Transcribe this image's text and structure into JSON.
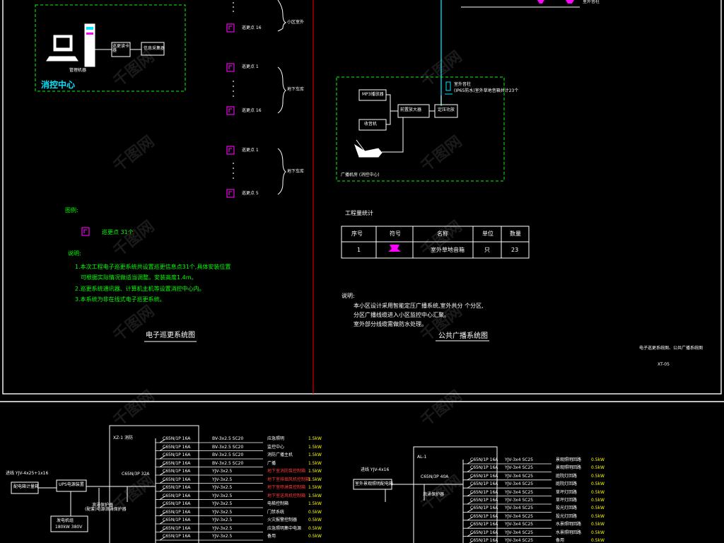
{
  "patrol": {
    "control_center_title": "消控中心",
    "computer_label": "管理机器",
    "box_interface": "巡更读卡器",
    "box_transmit": "信息采集器",
    "pt_top_upper": "巡更点 16",
    "pt_1a": "巡更点 1",
    "pt_16a": "巡更点 16",
    "pt_1b": "巡更点 1",
    "pt_5": "巡更点 5",
    "group_1": "小区室外",
    "group_2": "地下车库",
    "group_3": "地下车库",
    "legend_title": "图例:",
    "legend_item": "巡更点 31个",
    "notes_title": "说明:",
    "note_1": "1.本次工程电子巡更系统共设置巡更信息点31个,具体安装位置",
    "note_1b": "可根据实际情况做适当调整。安装高度1.4m。",
    "note_2": "2.巡更系统通讯器、计算机主机等设置消控中心内。",
    "note_3": "3.本系统为非在线式电子巡更系统。",
    "title": "电子巡更系统图"
  },
  "broadcast": {
    "box_mp3": "MP3播放器",
    "box_tuner": "收音机",
    "box_matrix": "前置放大器",
    "box_amp": "定压功放",
    "speaker_note_1": "室外音柱",
    "speaker_note_2": "(IP65防水)室外草地音箱共计23个",
    "room_label": "广播机房 (消控中心)",
    "top_note": "室外音柱",
    "qty_title": "工程量统计",
    "table_headers": [
      "序号",
      "符号",
      "名称",
      "单位",
      "数量"
    ],
    "table_rows": [
      {
        "no": "1",
        "name": "室外草地音箱",
        "unit": "只",
        "qty": "23"
      }
    ],
    "notes_title": "说明:",
    "note_1": "本小区设计采用智能定压广播系统,室外共分 个分区,",
    "note_2": "分区广播线缆进入小区监控中心汇聚。",
    "note_3": "室外部分线缆需做防水处理。",
    "title": "公共广播系统图",
    "frame_caption": "电子巡更系统图、公共广播系统图",
    "frame_code": "XT-05"
  },
  "panel_left": {
    "incoming_label": "进线 YJV-4x25+1x16",
    "meter_box": "配电箱计量箱",
    "main_switch_box": "UPS电源装置",
    "breaker_label": "C65N/3P 32A",
    "spd_label": "浪涌保护器",
    "spd_sub": "(配套)电源浪涌保护器",
    "gen_box_1": "发电机组",
    "gen_box_2": "180kW 380V",
    "cabinet_header": "XZ-1 消防",
    "circuits": [
      {
        "brk": "C65N/1P 16A",
        "cable": "BV-3x2.5 SC20",
        "name": "应急照明",
        "load": "1.5kW",
        "red": false
      },
      {
        "brk": "C65N/1P 16A",
        "cable": "BV-3x2.5 SC20",
        "name": "监控中心",
        "load": "1.5kW",
        "red": false
      },
      {
        "brk": "C65N/1P 16A",
        "cable": "BV-3x2.5 SC20",
        "name": "消防广播主机",
        "load": "1.5kW",
        "red": false
      },
      {
        "brk": "C65N/1P 16A",
        "cable": "BV-3x2.5 SC20",
        "name": "广播",
        "load": "1.5kW",
        "red": false
      },
      {
        "brk": "C65N/1P 16A",
        "cable": "YJV-3x2.5",
        "name": "地下室消防泵控制箱",
        "load": "1.5kW",
        "red": true
      },
      {
        "brk": "C65N/1P 16A",
        "cable": "YJV-3x2.5",
        "name": "地下室排烟风机控制箱",
        "load": "1.5kW",
        "red": true
      },
      {
        "brk": "C65N/1P 16A",
        "cable": "YJV-3x2.5",
        "name": "地下室喷淋泵控制箱",
        "load": "1.5kW",
        "red": true
      },
      {
        "brk": "C65N/1P 16A",
        "cable": "YJV-3x2.5",
        "name": "地下室送风机控制箱",
        "load": "1.5kW",
        "red": true
      },
      {
        "brk": "C65N/1P 16A",
        "cable": "YJV-3x2.5",
        "name": "电梯控制箱",
        "load": "1.5kW",
        "red": false
      },
      {
        "brk": "C65N/1P 16A",
        "cable": "YJV-3x2.5",
        "name": "门禁系统",
        "load": "0.5kW",
        "red": false
      },
      {
        "brk": "C65N/1P 16A",
        "cable": "YJV-3x2.5",
        "name": "火灾报警控制器",
        "load": "0.5kW",
        "red": false
      },
      {
        "brk": "C65N/1P 16A",
        "cable": "YJV-3x2.5",
        "name": "应急照明集中电源",
        "load": "0.5kW",
        "red": false
      },
      {
        "brk": "C65N/1P 16A",
        "cable": "YJV-3x2.5",
        "name": "备用",
        "load": "0.5kW",
        "red": false
      }
    ]
  },
  "panel_right": {
    "incoming_label": "进线 YJV-4x16",
    "switch_box": "室外景观照明配电箱",
    "breaker_label": "C65N/3P 40A",
    "spd_label": "浪涌保护器",
    "cabinet_header": "AL-1",
    "circuits": [
      {
        "brk": "C65N/1P 16A",
        "cable": "YJV-3x4 SC25",
        "name": "景观照明回路",
        "load": "0.5kW"
      },
      {
        "brk": "C65N/1P 16A",
        "cable": "YJV-3x4 SC25",
        "name": "景观照明回路",
        "load": "0.5kW"
      },
      {
        "brk": "C65N/1P 16A",
        "cable": "YJV-3x4 SC25",
        "name": "庭院灯回路",
        "load": "0.5kW"
      },
      {
        "brk": "C65N/1P 16A",
        "cable": "YJV-3x4 SC25",
        "name": "庭院灯回路",
        "load": "0.5kW"
      },
      {
        "brk": "C65N/1P 16A",
        "cable": "YJV-3x4 SC25",
        "name": "草坪灯回路",
        "load": "0.5kW"
      },
      {
        "brk": "C65N/1P 16A",
        "cable": "YJV-3x4 SC25",
        "name": "草坪灯回路",
        "load": "0.5kW"
      },
      {
        "brk": "C65N/1P 16A",
        "cable": "YJV-3x4 SC25",
        "name": "投光灯回路",
        "load": "0.5kW"
      },
      {
        "brk": "C65N/1P 16A",
        "cable": "YJV-3x4 SC25",
        "name": "投光灯回路",
        "load": "0.5kW"
      },
      {
        "brk": "C65N/1P 16A",
        "cable": "YJV-3x4 SC25",
        "name": "水景照明回路",
        "load": "0.5kW"
      },
      {
        "brk": "C65N/1P 16A",
        "cable": "YJV-3x4 SC25",
        "name": "水景照明回路",
        "load": "0.5kW"
      },
      {
        "brk": "C65N/1P 16A",
        "cable": "YJV-3x4 SC25",
        "name": "备用",
        "load": "0.5kW"
      }
    ]
  },
  "watermark": "千图网",
  "colors": {
    "frame": "#ffffff",
    "divider": "#ff0000",
    "dashed_box": "#00ff00",
    "symbol": "#ff00ff",
    "broadcast_line": "#00e5ff",
    "note_text": "#00ff00",
    "title_text": "#ffff00"
  }
}
